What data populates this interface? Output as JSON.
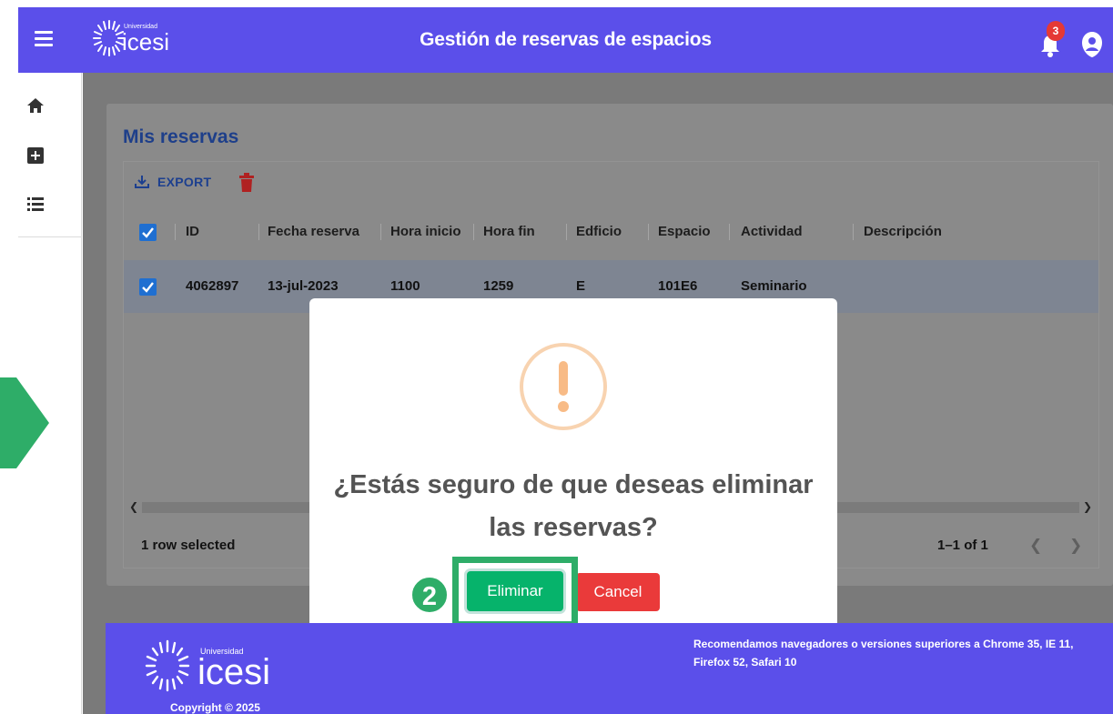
{
  "topbar": {
    "title": "Gestión de reservas de espacios",
    "logo_small": "Universidad",
    "logo_name": "icesi",
    "notification_count": "3"
  },
  "sidebar": {
    "items": [
      {
        "icon": "home-icon"
      },
      {
        "icon": "add-box-icon"
      },
      {
        "icon": "list-icon"
      }
    ]
  },
  "page": {
    "title": "Mis reservas",
    "export_label": "EXPORT"
  },
  "table": {
    "columns": [
      "ID",
      "Fecha reserva",
      "Hora inicio",
      "Hora fin",
      "Edficio",
      "Espacio",
      "Actividad",
      "Descripción"
    ],
    "rows": [
      {
        "id": "4062897",
        "fecha": "13-jul-2023",
        "hora_inicio": "1100",
        "hora_fin": "1259",
        "edificio": "E",
        "espacio": "101E6",
        "actividad": "Seminario",
        "descripcion": ""
      }
    ],
    "selected_text": "1 row selected",
    "pagination": "1–1 of 1"
  },
  "modal": {
    "question": "¿Estás seguro de que deseas eliminar las reservas?",
    "confirm_label": "Eliminar",
    "cancel_label": "Cancel"
  },
  "annotation": {
    "step": "2"
  },
  "footer": {
    "logo_small": "Universidad",
    "logo_name": "icesi",
    "copyright": "Copyright © 2025",
    "browser_note": "Recomendamos navegadores o versiones superiores a Chrome 35, IE 11, Firefox 52, Safari 10"
  },
  "colors": {
    "brand": "#5b4fea",
    "confirm": "#06b36b",
    "cancel": "#ea3a3a",
    "annotation": "#2ead68",
    "warning": "#f8bb86"
  }
}
